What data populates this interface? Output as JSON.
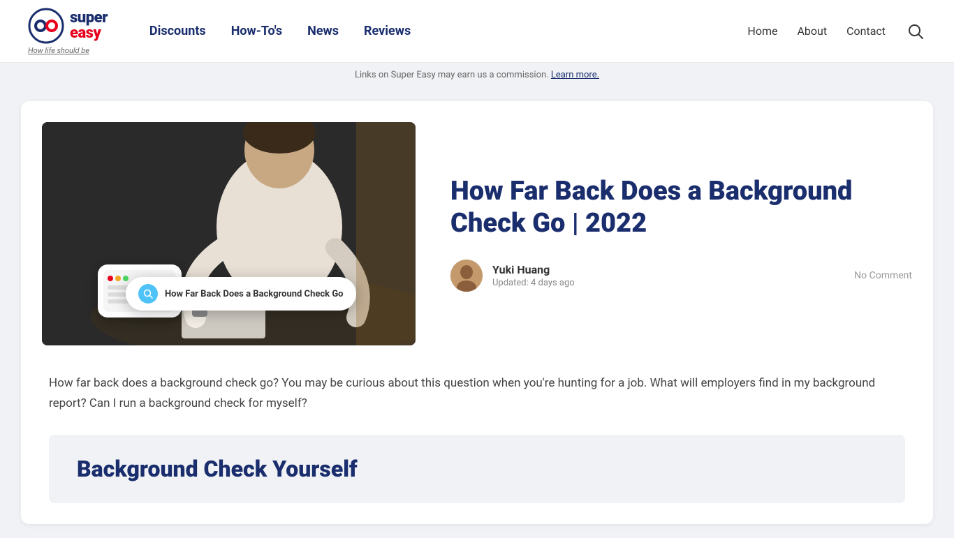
{
  "site": {
    "logo_super": "super",
    "logo_easy": "easy",
    "logo_tagline_prefix": "How life ",
    "logo_tagline_emphasis": "should",
    "logo_tagline_suffix": " be"
  },
  "nav_main": {
    "items": [
      {
        "label": "Discounts",
        "href": "#"
      },
      {
        "label": "How-To's",
        "href": "#"
      },
      {
        "label": "News",
        "href": "#"
      },
      {
        "label": "Reviews",
        "href": "#"
      }
    ]
  },
  "nav_right": {
    "items": [
      {
        "label": "Home",
        "href": "#"
      },
      {
        "label": "About",
        "href": "#"
      },
      {
        "label": "Contact",
        "href": "#"
      }
    ]
  },
  "commission_bar": {
    "text": "Links on Super Easy may earn us a commission. Learn more."
  },
  "article": {
    "title": "How Far Back Does a Background Check Go | 2022",
    "author_name": "Yuki Huang",
    "updated": "Updated: 4 days ago",
    "comment_count": "No Comment",
    "intro_text": "How far back does a background check go? You may be curious about this question when you're hunting for a job. What will employers find in my background report? Can I run a background check for myself?",
    "search_image_text": "How Far Back Does a Background Check Go",
    "section_title": "Background Check Yourself"
  }
}
